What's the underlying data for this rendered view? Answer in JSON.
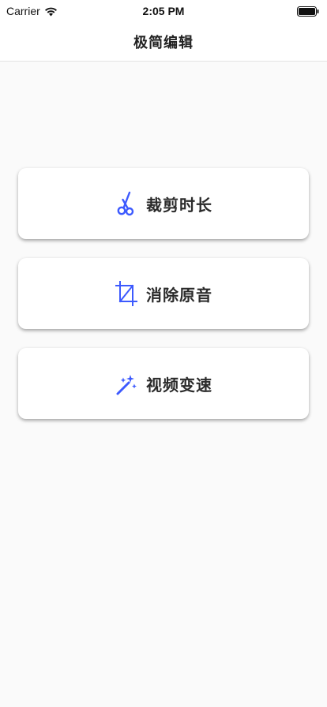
{
  "status_bar": {
    "carrier": "Carrier",
    "time": "2:05 PM",
    "wifi_icon": "wifi-icon",
    "battery_icon": "battery-icon"
  },
  "nav": {
    "title": "极简编辑"
  },
  "actions": [
    {
      "label": "裁剪时长",
      "icon": "scissors-icon"
    },
    {
      "label": "消除原音",
      "icon": "crop-icon"
    },
    {
      "label": "视频变速",
      "icon": "magic-wand-icon"
    }
  ],
  "colors": {
    "accent": "#3d5afe",
    "background": "#fafafa",
    "card": "#ffffff"
  }
}
